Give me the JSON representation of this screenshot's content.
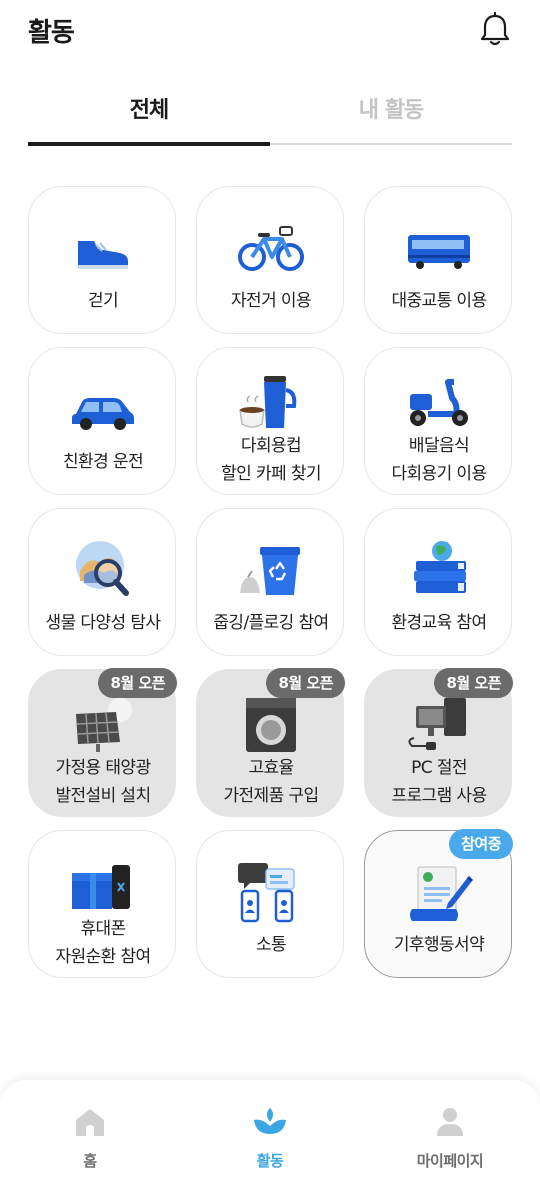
{
  "header": {
    "title": "활동",
    "bell_icon": "bell-icon"
  },
  "tabs": [
    {
      "label": "전체",
      "active": true
    },
    {
      "label": "내 활동",
      "active": false
    }
  ],
  "activities": [
    {
      "lines": [
        "걷기"
      ],
      "icon": "shoe-icon"
    },
    {
      "lines": [
        "자전거 이용"
      ],
      "icon": "bicycle-icon"
    },
    {
      "lines": [
        "대중교통 이용"
      ],
      "icon": "bus-icon"
    },
    {
      "lines": [
        "친환경 운전"
      ],
      "icon": "car-icon"
    },
    {
      "lines": [
        "다회용컵",
        "할인 카페 찾기"
      ],
      "icon": "tumbler-icon"
    },
    {
      "lines": [
        "배달음식",
        "다회용기 이용"
      ],
      "icon": "scooter-icon"
    },
    {
      "lines": [
        "생물 다양성 탐사"
      ],
      "icon": "magnifier-globe-icon"
    },
    {
      "lines": [
        "줍깅/플로깅 참여"
      ],
      "icon": "recycle-bin-icon"
    },
    {
      "lines": [
        "환경교육 참여"
      ],
      "icon": "books-globe-icon"
    },
    {
      "lines": [
        "가정용 태양광",
        "발전설비 설치"
      ],
      "icon": "solar-panel-icon",
      "badge": "8월 오픈"
    },
    {
      "lines": [
        "고효율",
        "가전제품 구입"
      ],
      "icon": "washing-machine-icon",
      "badge": "8월 오픈"
    },
    {
      "lines": [
        "PC 절전",
        "프로그램 사용"
      ],
      "icon": "computer-icon",
      "badge": "8월 오픈"
    },
    {
      "lines": [
        "휴대폰",
        "자원순환 참여"
      ],
      "icon": "phone-box-icon"
    },
    {
      "lines": [
        "소통"
      ],
      "icon": "chat-phones-icon"
    },
    {
      "lines": [
        "기후행동서약"
      ],
      "icon": "pledge-scroll-icon",
      "badge": "참여중"
    }
  ],
  "bottom_nav": [
    {
      "label": "홈",
      "icon": "home-icon",
      "active": false
    },
    {
      "label": "활동",
      "icon": "leaf-hands-icon",
      "active": true
    },
    {
      "label": "마이페이지",
      "icon": "person-icon",
      "active": false
    }
  ],
  "colors": {
    "accent": "#3aa6e4",
    "icon_blue": "#1f5fd6",
    "badge_gray": "#6b6b6b",
    "badge_blue": "#4aa9ea"
  }
}
